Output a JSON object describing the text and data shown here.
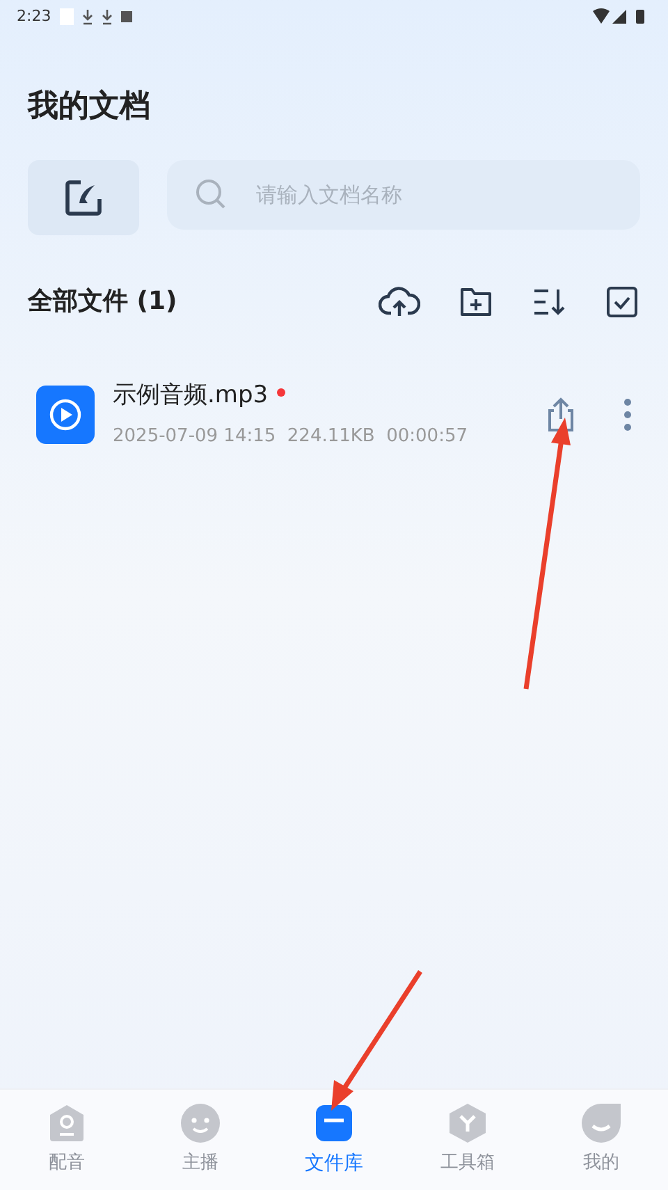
{
  "status_bar": {
    "time": "2:23"
  },
  "title": "我的文档",
  "search": {
    "placeholder": "请输入文档名称"
  },
  "files_header": {
    "label": "全部文件 (1)"
  },
  "files": [
    {
      "name": "示例音频.mp3",
      "unread": true,
      "meta": "2025-07-09 14:15  224.11KB  00:00:57"
    }
  ],
  "nav": [
    {
      "kind": "dubbing",
      "label": "配音",
      "selected": false
    },
    {
      "kind": "anchor",
      "label": "主播",
      "selected": false
    },
    {
      "kind": "files",
      "label": "文件库",
      "selected": true
    },
    {
      "kind": "tools",
      "label": "工具箱",
      "selected": false
    },
    {
      "kind": "me",
      "label": "我的",
      "selected": false
    }
  ]
}
